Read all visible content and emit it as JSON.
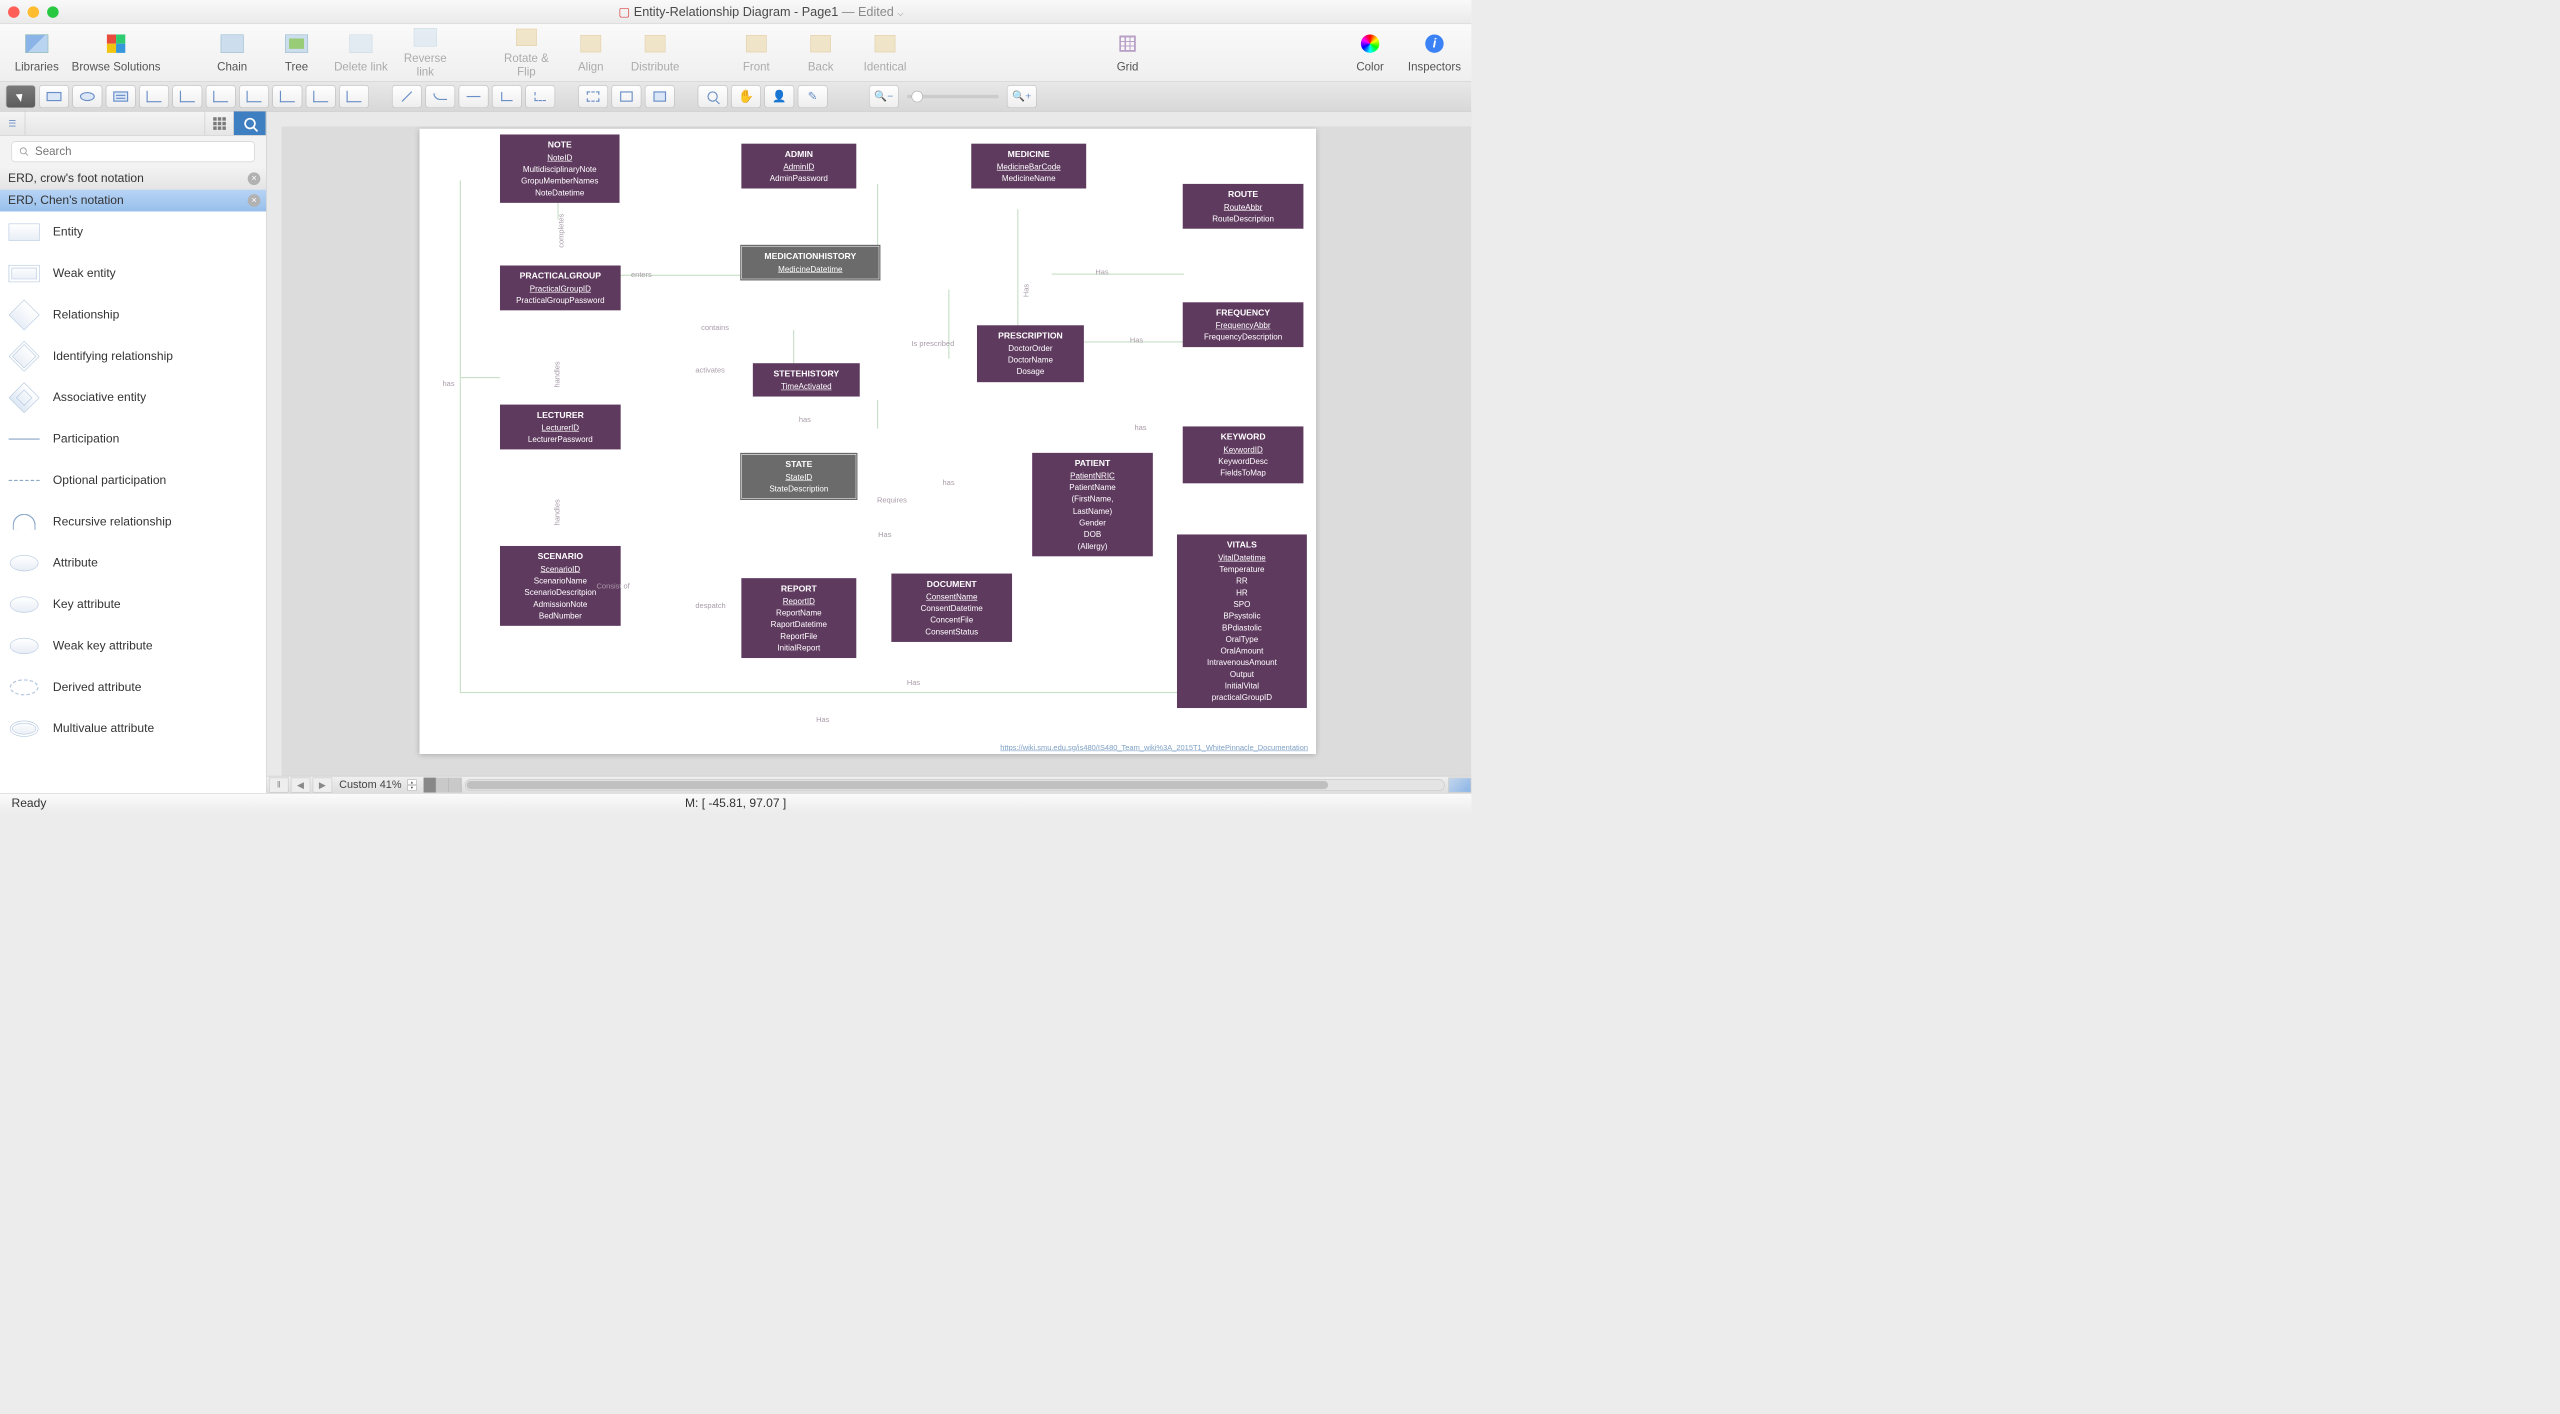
{
  "title": {
    "doc": "Entity-Relationship Diagram - Page1",
    "edited": "— Edited"
  },
  "maintb": {
    "libraries": "Libraries",
    "browse": "Browse Solutions",
    "chain": "Chain",
    "tree": "Tree",
    "deletelink": "Delete link",
    "reverselink": "Reverse link",
    "rotate": "Rotate & Flip",
    "align": "Align",
    "distribute": "Distribute",
    "front": "Front",
    "back": "Back",
    "identical": "Identical",
    "grid": "Grid",
    "color": "Color",
    "inspectors": "Inspectors"
  },
  "searchPlaceholder": "Search",
  "lib1": "ERD, crow's foot notation",
  "lib2": "ERD, Chen's notation",
  "shapes": [
    "Entity",
    "Weak entity",
    "Relationship",
    "Identifying relationship",
    "Associative entity",
    "Participation",
    "Optional participation",
    "Recursive relationship",
    "Attribute",
    "Key attribute",
    "Weak key attribute",
    "Derived attribute",
    "Multivalue attribute"
  ],
  "zoom": "Custom 41%",
  "status": {
    "ready": "Ready",
    "coords": "M: [ -45.81, 97.07 ]"
  },
  "pageLink": "https://wiki.smu.edu.sg/is480/IS480_Team_wiki%3A_2015T1_WhitePinnacle_Documentation",
  "entities": {
    "note": {
      "title": "NOTE",
      "attrs": [
        "NoteID",
        "MultidisciplinaryNote",
        "GropuMemberNames",
        "NoteDatetime"
      ]
    },
    "admin": {
      "title": "ADMIN",
      "attrs": [
        "AdminID",
        "AdminPassword"
      ]
    },
    "medicine": {
      "title": "MEDICINE",
      "attrs": [
        "MedicineBarCode",
        "MedicineName"
      ]
    },
    "route": {
      "title": "ROUTE",
      "attrs": [
        "RouteAbbr",
        "RouteDescription"
      ]
    },
    "practicalgroup": {
      "title": "PRACTICALGROUP",
      "attrs": [
        "PracticalGroupID",
        "PracticalGroupPassword"
      ]
    },
    "medicationhistory": {
      "title": "MEDICATIONHISTORY",
      "attrs": [
        "MedicineDatetime"
      ]
    },
    "frequency": {
      "title": "FREQUENCY",
      "attrs": [
        "FrequencyAbbr",
        "FrequencyDescription"
      ]
    },
    "prescription": {
      "title": "PRESCRIPTION",
      "attrs": [
        "DoctorOrder",
        "DoctorName",
        "Dosage"
      ]
    },
    "stetehistory": {
      "title": "STETEHISTORY",
      "attrs": [
        "TimeActivated"
      ]
    },
    "lecturer": {
      "title": "LECTURER",
      "attrs": [
        "LecturerID",
        "LecturerPassword"
      ]
    },
    "keyword": {
      "title": "KEYWORD",
      "attrs": [
        "KeywordID",
        "KeywordDesc",
        "FieldsToMap"
      ]
    },
    "state": {
      "title": "STATE",
      "attrs": [
        "StateID",
        "StateDescription"
      ]
    },
    "scenario": {
      "title": "SCENARIO",
      "attrs": [
        "ScenarioID",
        "ScenarioName",
        "ScenarioDescritpion",
        "AdmissionNote",
        "BedNumber"
      ]
    },
    "patient": {
      "title": "PATIENT",
      "attrs": [
        "PatientNRIC",
        "PatientName",
        "(FirstName,",
        "LastName)",
        "Gender",
        "DOB",
        "(Allergy)"
      ]
    },
    "report": {
      "title": "REPORT",
      "attrs": [
        "ReportID",
        "ReportName",
        "RaportDatetime",
        "ReportFile",
        "InitialReport"
      ]
    },
    "document": {
      "title": "DOCUMENT",
      "attrs": [
        "ConsentName",
        "ConsentDatetime",
        "ConcentFile",
        "ConsentStatus"
      ]
    },
    "vitals": {
      "title": "VITALS",
      "attrs": [
        "VitalDatetime",
        "Temperature",
        "RR",
        "HR",
        "SPO",
        "BPsystolic",
        "BPdiastolic",
        "OralType",
        "OralAmount",
        "IntravenousAmount",
        "Output",
        "InitialVital",
        "practicalGroupID"
      ]
    }
  },
  "edgeLabels": {
    "completes": "completes",
    "enters": "enters",
    "has1": "has",
    "has2": "Has",
    "has3": "Has",
    "has4": "Has",
    "has5": "has",
    "has6": "has",
    "has7": "has",
    "has8": "Has",
    "has9": "Has",
    "has10": "Has",
    "contains": "contains",
    "activates": "activates",
    "handles": "handles",
    "handles2": "handles",
    "isprescribed": "Is prescribed",
    "requires": "Requires",
    "consistof": "Consist of",
    "despatch": "despatch"
  }
}
